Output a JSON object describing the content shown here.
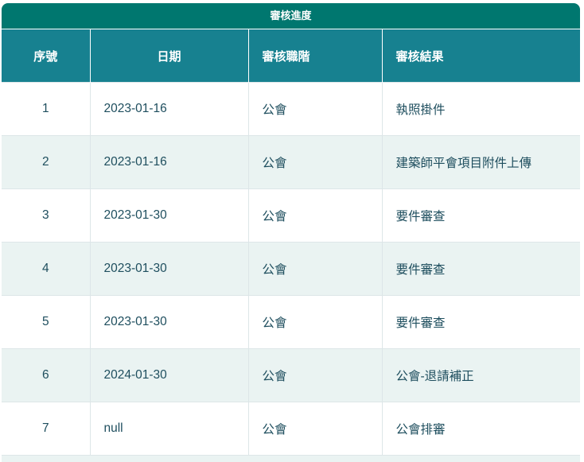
{
  "title": "審核進度",
  "columns": [
    "序號",
    "日期",
    "審核職階",
    "審核結果"
  ],
  "rows": [
    {
      "no": "1",
      "date": "2023-01-16",
      "level": "公會",
      "result": "執照掛件"
    },
    {
      "no": "2",
      "date": "2023-01-16",
      "level": "公會",
      "result": "建築師平會項目附件上傳"
    },
    {
      "no": "3",
      "date": "2023-01-30",
      "level": "公會",
      "result": "要件審查"
    },
    {
      "no": "4",
      "date": "2023-01-30",
      "level": "公會",
      "result": "要件審查"
    },
    {
      "no": "5",
      "date": "2023-01-30",
      "level": "公會",
      "result": "要件審查"
    },
    {
      "no": "6",
      "date": "2024-01-30",
      "level": "公會",
      "result": "公會-退請補正"
    },
    {
      "no": "7",
      "date": "null",
      "level": "公會",
      "result": "公會排審"
    }
  ]
}
